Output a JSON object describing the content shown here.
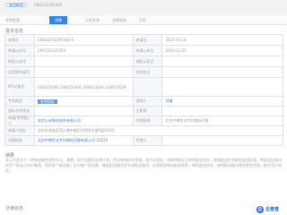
{
  "header": {
    "tag": "实用新型",
    "code": "CN112132530A"
  },
  "tabs": [
    {
      "label": "专利信息",
      "active": false
    },
    {
      "label": "详情",
      "active": true
    },
    {
      "label": "公开文本",
      "active": false
    },
    {
      "label": "法律状态",
      "active": false
    },
    {
      "label": "引证",
      "active": false
    }
  ],
  "section_title": "基本信息",
  "fields": {
    "r1": {
      "l1": "申请号",
      "v1": "CN202011097183.0",
      "l2": "申请日",
      "v2": "2020-10-14"
    },
    "r2": {
      "l1": "申请公布号",
      "v1": "CN112132530A",
      "l2": "申请公布日",
      "v2": "2020-12-25"
    },
    "r3": {
      "l1": "授权公告号",
      "v1": "",
      "l2": "授权公告日",
      "v2": ""
    },
    "r4": {
      "l1": "分案原申请号",
      "v1": "",
      "l2": "优先权日",
      "v2": ""
    },
    "r5": {
      "l1": "IPC分类号",
      "v1": "G06Q10/08; G06Q10/06; G06Q10/04; G06F16/29",
      "l2": "",
      "v2": ""
    },
    "r6": {
      "l1": "专利类型",
      "v1": "发明授权",
      "l2": "发明人",
      "v2": "详情"
    },
    "r7": {
      "l1": "国际专利状态",
      "v1": "",
      "l2": "主权项",
      "v2": ""
    },
    "r8": {
      "l1": "申请(专利权)人",
      "v1": "北京小米移动软件有限公司",
      "l2": "代理机构",
      "v2": "北京中博世达专利商标代理"
    },
    "r9": {
      "l1": "申请人地址",
      "v1": "北京市海淀区西二旗中路33号院6号楼9层019号"
    },
    "r10": {
      "l1": "代理机构",
      "v1": "北京中博世达专利商标代理有限公司 11274",
      "l2": "代理人",
      "v2": ""
    }
  },
  "desc_title": "摘要",
  "description": "本公开是关于一种物流路径规划方法、装置、电子设备及存储介质，涉及物流技术领域。该方法包括：获取待配送订单的配送信息，根据配送信息确定配送区域，将配送区域内的多个配送点进行聚类，得到多个配送簇；针对每个配送簇，确定配送顺序并生成配送路径，从而提高物流配送效率，降低配送成本，使得配送路径规划更加合理，提升用户体验。",
  "bottom_title": "法律状态",
  "logo": {
    "mark": "企",
    "text": "企查查"
  }
}
